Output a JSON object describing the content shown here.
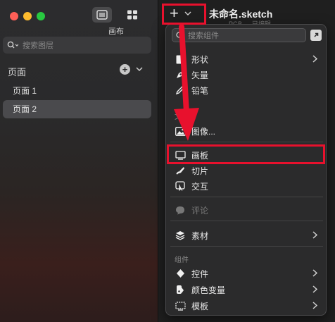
{
  "sidebar": {
    "view_label": "画布",
    "search_placeholder": "搜索图层",
    "pages_title": "页面",
    "add_label": "+",
    "pages": [
      {
        "label": "页面 1",
        "selected": false
      },
      {
        "label": "页面 2",
        "selected": true
      }
    ]
  },
  "toolbar": {
    "plus_label": "+",
    "doc_title": "未命名.sketch",
    "doc_subtitle": "PGB — 已编辑"
  },
  "menu": {
    "search_placeholder": "搜索组件",
    "items": {
      "shape": "形状",
      "vector": "矢量",
      "pencil": "铅笔",
      "text_section": "文本",
      "image": "图像...",
      "artboard": "画板",
      "slice": "切片",
      "interaction": "交互",
      "comment": "评论",
      "assets": "素材",
      "components_section": "组件",
      "symbols": "控件",
      "color_variables": "颜色变量",
      "templates": "模板"
    }
  },
  "annotation_color": "#e8112d"
}
